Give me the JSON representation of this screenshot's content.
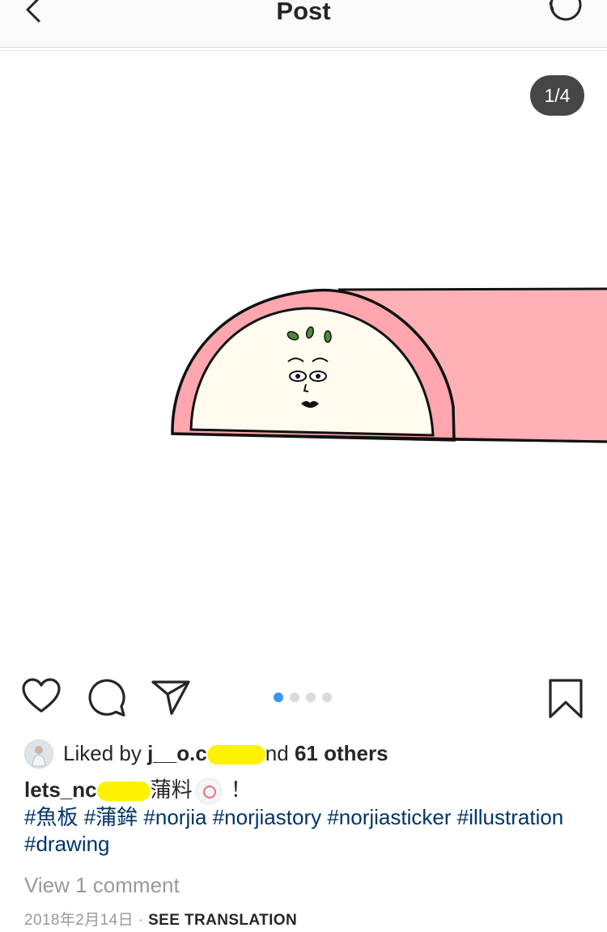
{
  "header": {
    "title": "Post",
    "back_icon": "chevron-left-icon",
    "refresh_icon": "refresh-icon"
  },
  "media": {
    "counter": "1/4",
    "image": "illustration-kamaboko-fishcake-character"
  },
  "actions": {
    "like_icon": "heart-icon",
    "comment_icon": "comment-icon",
    "share_icon": "direct-send-icon",
    "save_icon": "bookmark-icon",
    "carousel_dots": 4,
    "active_dot": 1
  },
  "likes": {
    "prefix": "Liked by ",
    "user_visible_start": "j__o.c",
    "and_suffix": "nd ",
    "count": "61 others"
  },
  "caption": {
    "username_visible": "lets_nc",
    "text_after_redaction": "蒲料",
    "suffix": "！",
    "tags": [
      "#魚板",
      "#蒲鉾",
      "#norjia",
      "#norjiastory",
      "#norjiasticker",
      "#illustration",
      "#drawing"
    ]
  },
  "comments": {
    "label": "View 1 comment"
  },
  "meta": {
    "date": "2018年2月14日",
    "separator": " · ",
    "translation": "SEE TRANSLATION"
  },
  "colors": {
    "accent": "#3897f0",
    "hashtag": "#003569",
    "muted": "#999999",
    "redaction": "#fdf200",
    "fishcake_pink": "#ffb1b6"
  }
}
